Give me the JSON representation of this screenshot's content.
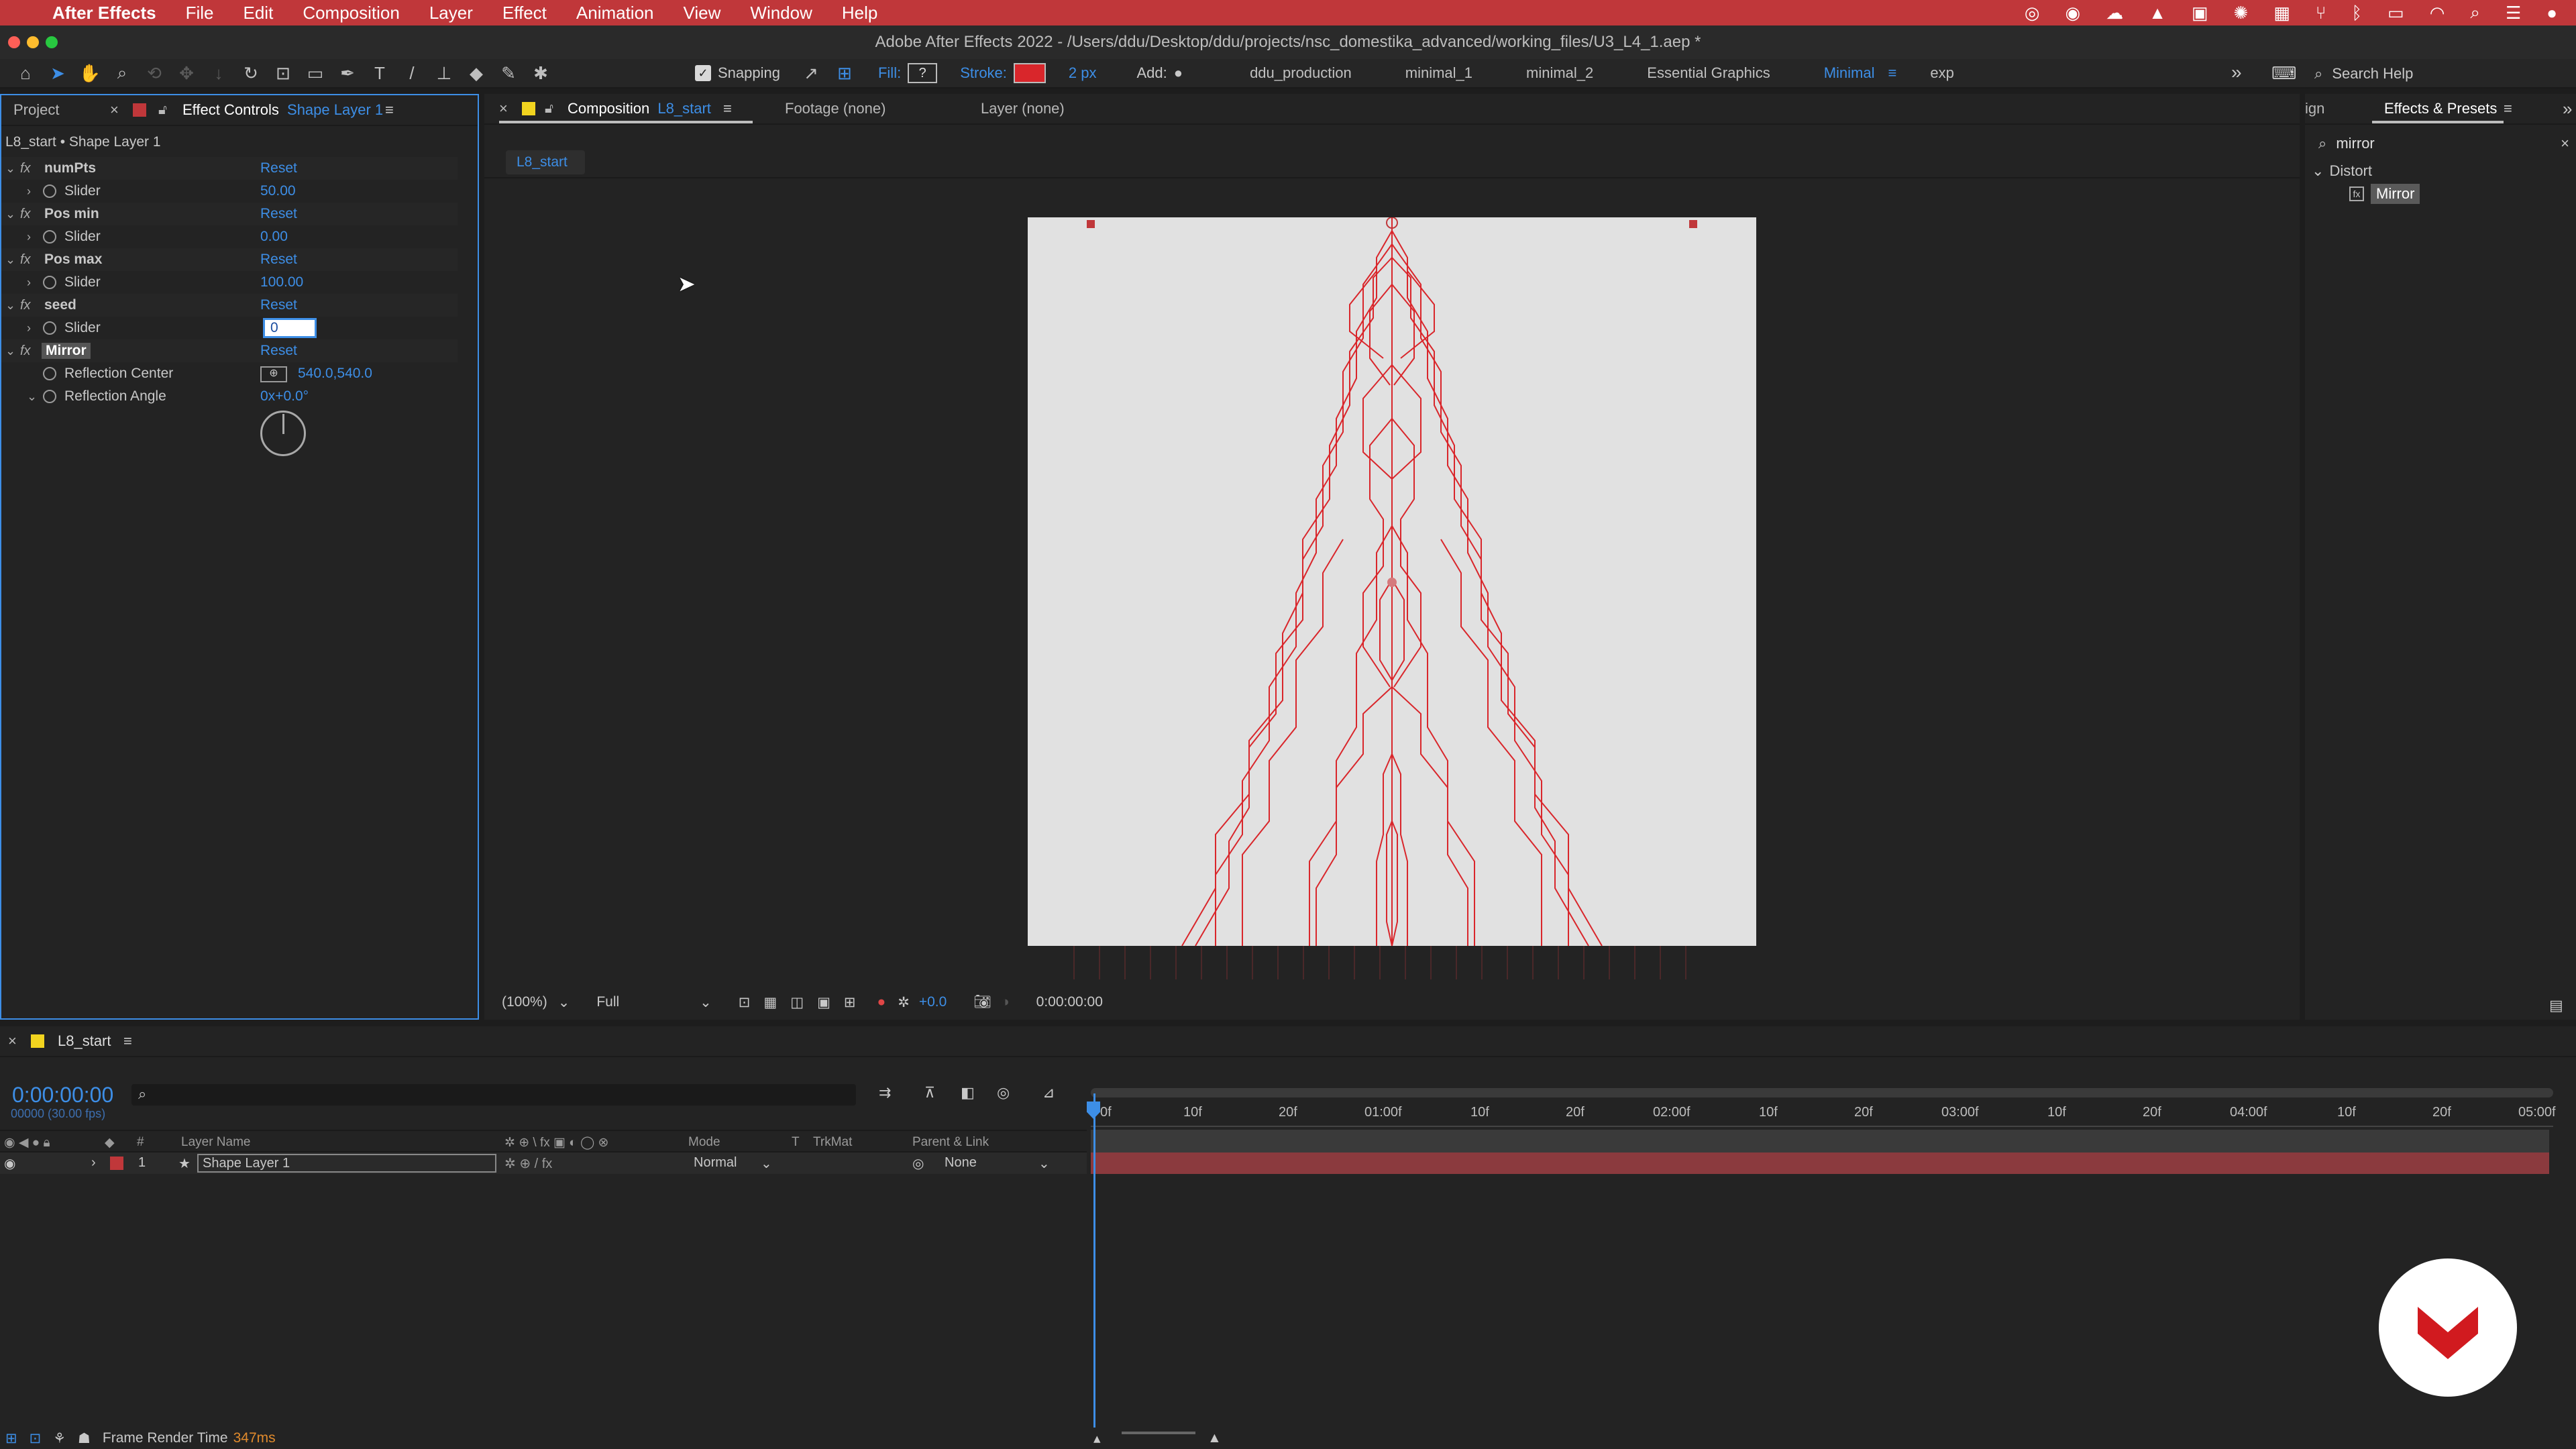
{
  "menubar": {
    "app_name": "After Effects",
    "items": [
      "File",
      "Edit",
      "Composition",
      "Layer",
      "Effect",
      "Animation",
      "View",
      "Window",
      "Help"
    ]
  },
  "titlebar": {
    "title": "Adobe After Effects 2022 - /Users/ddu/Desktop/ddu/projects/nsc_domestika_advanced/working_files/U3_L4_1.aep *"
  },
  "toolbar": {
    "snapping_label": "Snapping",
    "fill_label": "Fill:",
    "stroke_label": "Stroke:",
    "stroke_width": "2 px",
    "add_label": "Add:",
    "workspaces": [
      "ddu_production",
      "minimal_1",
      "minimal_2",
      "Essential Graphics",
      "Minimal",
      "exp"
    ],
    "active_workspace": "Minimal",
    "search_placeholder": "Search Help",
    "accent_color": "#3d8ee6",
    "stroke_color": "#d9262b"
  },
  "left_panel": {
    "tab_project": "Project",
    "tab_effect_controls": "Effect Controls",
    "tab_effect_controls_layer": "Shape Layer 1",
    "breadcrumb": "L8_start • Shape Layer 1",
    "effects": [
      {
        "name": "numPts",
        "reset": "Reset",
        "param": "Slider",
        "value": "50.00"
      },
      {
        "name": "Pos min",
        "reset": "Reset",
        "param": "Slider",
        "value": "0.00"
      },
      {
        "name": "Pos max",
        "reset": "Reset",
        "param": "Slider",
        "value": "100.00"
      },
      {
        "name": "seed",
        "reset": "Reset",
        "param": "Slider",
        "value": "0"
      }
    ],
    "mirror": {
      "name": "Mirror",
      "reset": "Reset",
      "reflection_center_label": "Reflection Center",
      "reflection_center_value": "540.0,540.0",
      "reflection_angle_label": "Reflection Angle",
      "reflection_angle_value": "0x+0.0°"
    }
  },
  "comp_panel": {
    "tab_composition": "Composition",
    "tab_composition_name": "L8_start",
    "tab_footage": "Footage (none)",
    "tab_layer": "Layer (none)",
    "subtab": "L8_start",
    "zoom": "(100%)",
    "resolution": "Full",
    "exposure": "+0.0",
    "timecode": "0:00:00:00",
    "canvas_bg": "#e1e1e1",
    "art_color": "#d9262b"
  },
  "right_panel": {
    "tab_partial": "ign",
    "tab_effects_presets": "Effects & Presets",
    "search_value": "mirror",
    "category": "Distort",
    "result": "Mirror"
  },
  "timeline": {
    "comp_tab": "L8_start",
    "timecode": "0:00:00:00",
    "fps_note": "00000 (30.00 fps)",
    "columns": {
      "layer_name": "Layer Name",
      "mode": "Mode",
      "t": "T",
      "trkmat": "TrkMat",
      "parent": "Parent & Link"
    },
    "layers": [
      {
        "index": "1",
        "name": "Shape Layer 1",
        "mode": "Normal",
        "parent": "None",
        "label_color": "#c0373a"
      }
    ],
    "ruler": [
      "0f",
      "10f",
      "20f",
      "01:00f",
      "10f",
      "20f",
      "02:00f",
      "10f",
      "20f",
      "03:00f",
      "10f",
      "20f",
      "04:00f",
      "10f",
      "20f",
      "05:00f"
    ],
    "bar_color": "#8b3a3e"
  },
  "statusbar": {
    "label": "Frame Render Time",
    "value": "347ms"
  }
}
